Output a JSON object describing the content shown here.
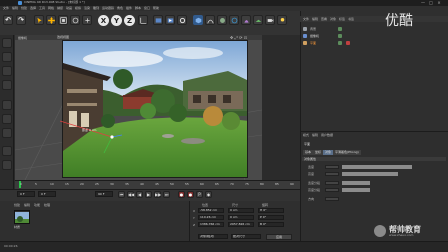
{
  "window": {
    "title": "CINEMA 4D R13.008 Studio - [未标题 1 *]",
    "controls": [
      "—",
      "□",
      "×"
    ]
  },
  "menubar": [
    "文件",
    "编辑",
    "创建",
    "选择",
    "工具",
    "网格",
    "捕捉",
    "动画",
    "模拟",
    "渲染",
    "雕刻",
    "运动跟踪",
    "角色",
    "插件",
    "脚本",
    "窗口",
    "帮助"
  ],
  "toolbar": {
    "undo": "↶",
    "redo": "↷",
    "x_label": "X",
    "y_label": "Y",
    "z_label": "Z"
  },
  "viewport": {
    "menu_label": "摄像机",
    "toggle_label": "透视视图",
    "icons": "✥ ⤢ ⟳ ⊡",
    "annotation": "原点 0 cm"
  },
  "object_manager": {
    "menu": [
      "文件",
      "编辑",
      "查看",
      "对象",
      "标签",
      "书签"
    ],
    "rows": [
      {
        "name": "背景",
        "color": "#9aa0a8"
      },
      {
        "name": "摄像机",
        "color": "#6a8fd0"
      },
      {
        "name": "平面",
        "color": "#d0a060"
      }
    ]
  },
  "watermark": "优酷",
  "attributes": {
    "menu": [
      "模式",
      "编辑",
      "用户数据"
    ],
    "object_label": "平面",
    "tabs": [
      "基本",
      "坐标",
      "对象",
      "平滑着色(Phong)"
    ],
    "active_tab": 2,
    "section": "对象属性",
    "rows": [
      {
        "label": "宽度",
        "value": "",
        "bar": 0.5
      },
      {
        "label": "高度",
        "value": "",
        "bar": 0.4
      },
      {
        "label": "宽度分段",
        "value": "",
        "bar": 0.2
      },
      {
        "label": "高度分段",
        "value": "",
        "bar": 0.2
      },
      {
        "label": "方向",
        "value": "",
        "bar": 0.0
      }
    ]
  },
  "timeline": {
    "ticks": [
      "0",
      "5",
      "10",
      "15",
      "20",
      "25",
      "30",
      "35",
      "40",
      "45",
      "50",
      "55",
      "60",
      "65",
      "70",
      "75",
      "80",
      "85",
      "90"
    ],
    "current_frame_field": "0 F",
    "start_field": "0 F",
    "end_field": "90 F"
  },
  "transport": {
    "buttons": [
      "⏮",
      "◀◀",
      "◀",
      "▶",
      "▶▶",
      "⏭"
    ],
    "record_buttons": [
      "●",
      "●",
      "P",
      "◆"
    ]
  },
  "materials": {
    "menu": [
      "创建",
      "编辑",
      "功能",
      "纹理"
    ],
    "item_label": "材质"
  },
  "coordinates": {
    "headers": [
      "位置",
      "尺寸",
      "旋转"
    ],
    "rows": [
      {
        "axis": "X",
        "pos": "-58.852 cm",
        "size": "0 cm",
        "rot": "H 0°"
      },
      {
        "axis": "Y",
        "pos": "110.26 cm",
        "size": "0 cm",
        "rot": "P 0°"
      },
      {
        "axis": "Z",
        "pos": "1386.766 cm",
        "size": "2957.826 cm",
        "rot": "B 0°"
      }
    ],
    "mode_left": "对象(相对)",
    "mode_right": "绝对尺寸",
    "apply": "应用"
  },
  "status": "00:00:26",
  "brand": {
    "name": "帮帅教育",
    "url": "www.zheuo.com"
  },
  "colors": {
    "accent": "#4a90d9",
    "timeline_marker": "#29c64a",
    "active_tab": "#5a6f8a"
  }
}
